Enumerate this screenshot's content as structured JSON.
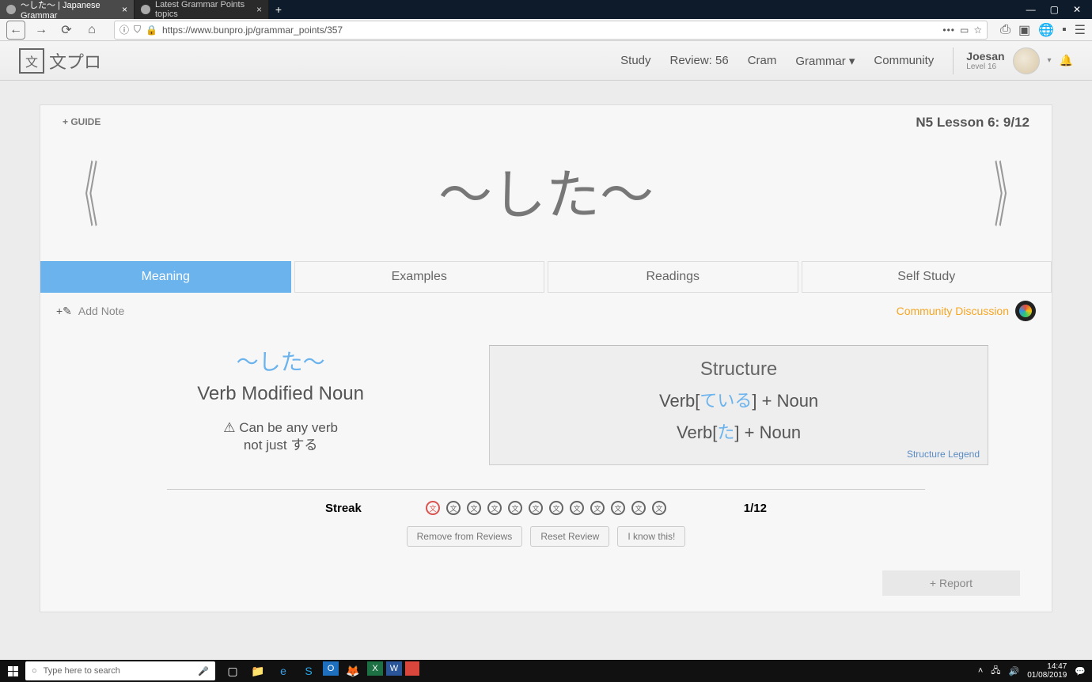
{
  "browser": {
    "tabs": [
      {
        "title": "〜した〜 | Japanese Grammar",
        "active": true
      },
      {
        "title": "Latest Grammar Points topics",
        "active": false
      }
    ],
    "url": "https://www.bunpro.jp/grammar_points/357"
  },
  "window_controls": {
    "minimize": "—",
    "maximize": "▢",
    "close": "✕"
  },
  "site": {
    "logo_text": "文プロ",
    "nav": {
      "study": "Study",
      "review": "Review: 56",
      "cram": "Cram",
      "grammar": "Grammar",
      "community": "Community"
    },
    "user": {
      "name": "Joesan",
      "level": "Level 16"
    }
  },
  "hero": {
    "guide": "+ GUIDE",
    "lesson": "N5 Lesson 6: 9/12",
    "title": "〜した〜"
  },
  "tabs": {
    "meaning": "Meaning",
    "examples": "Examples",
    "readings": "Readings",
    "selfstudy": "Self Study"
  },
  "note_row": {
    "add_note": "Add Note",
    "community": "Community Discussion"
  },
  "meaning": {
    "kana": "〜した〜",
    "english": "Verb Modified Noun",
    "note_line1": "⚠ Can be any verb",
    "note_line2": "not just する"
  },
  "structure": {
    "title": "Structure",
    "line1_pre": "Verb[",
    "line1_blue": "ている",
    "line1_post": "] + Noun",
    "line2_pre": "Verb[",
    "line2_blue": "た",
    "line2_post": "] + Noun",
    "legend": "Structure Legend"
  },
  "streak": {
    "label": "Streak",
    "count": "1/12",
    "buttons": {
      "remove": "Remove from Reviews",
      "reset": "Reset Review",
      "know": "I know this!"
    }
  },
  "report": "+ Report",
  "taskbar": {
    "search_placeholder": "Type here to search",
    "time": "14:47",
    "date": "01/08/2019"
  }
}
